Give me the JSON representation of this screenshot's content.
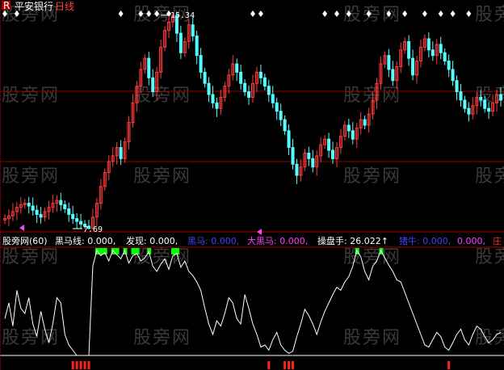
{
  "header": {
    "flag": "R",
    "stock_name": "平安银行",
    "period": "日线"
  },
  "watermark_text": "股旁网",
  "price_panel": {
    "high_label": "15.34",
    "low_label": "7.69",
    "colors": {
      "up": "#ff3a3a",
      "down": "#54ffff",
      "grid": "#8b0000",
      "signal": "#ffffff"
    }
  },
  "indicator_legend": {
    "prefix": "股旁网(60)",
    "items": [
      {
        "text": "黑马线: 0.000,",
        "color": "#ffffff"
      },
      {
        "text": "发现: 0.000,",
        "color": "#ffffff"
      },
      {
        "text": "黑马: 0.000,",
        "color": "#4040ff"
      },
      {
        "text": "大黑马: 0.000,",
        "color": "#ff40ff"
      },
      {
        "text": "操盘手: 26.022↑",
        "color": "#ffffff"
      },
      {
        "text": "猪牛: 0.000,",
        "color": "#4040ff"
      },
      {
        "text": "0.000,",
        "color": "#ff40ff"
      },
      {
        "text": "庄",
        "color": "#ff2020"
      }
    ]
  },
  "chart_data": {
    "type": "candlestick",
    "price_range": [
      7.69,
      15.34
    ],
    "marked_high": 15.34,
    "marked_low": 7.69,
    "close_series": [
      8.05,
      8.15,
      8.3,
      8.45,
      8.55,
      8.6,
      8.5,
      8.35,
      8.2,
      8.1,
      8.3,
      8.45,
      8.6,
      8.7,
      8.55,
      8.4,
      8.2,
      8.05,
      7.95,
      7.85,
      7.78,
      7.69,
      8.1,
      8.6,
      9.2,
      9.7,
      10.1,
      10.3,
      10.6,
      10.2,
      10.8,
      11.5,
      12.2,
      12.8,
      13.4,
      13.8,
      13.1,
      12.6,
      13.3,
      14.2,
      14.8,
      15.1,
      15.34,
      14.7,
      14.0,
      14.4,
      15.0,
      14.6,
      13.9,
      13.3,
      12.9,
      12.5,
      12.2,
      12.0,
      12.4,
      12.8,
      13.2,
      13.6,
      13.3,
      12.9,
      12.6,
      12.4,
      12.9,
      13.3,
      13.1,
      12.8,
      12.5,
      12.2,
      11.9,
      11.6,
      11.2,
      10.6,
      10.0,
      9.6,
      9.9,
      10.4,
      10.2,
      9.9,
      10.3,
      10.7,
      10.9,
      10.5,
      10.2,
      10.6,
      11.0,
      11.4,
      11.2,
      10.9,
      11.3,
      11.6,
      11.4,
      11.8,
      12.3,
      12.9,
      13.6,
      13.9,
      13.4,
      13.0,
      13.5,
      14.1,
      14.4,
      13.8,
      13.2,
      13.7,
      14.2,
      14.5,
      14.1,
      13.9,
      14.3,
      14.0,
      13.7,
      13.4,
      13.0,
      12.6,
      12.3,
      12.0,
      11.8,
      12.1,
      12.4,
      12.3,
      12.0,
      11.9,
      12.2,
      12.5,
      12.3
    ],
    "indicator_series": [
      0.35,
      0.5,
      0.28,
      0.62,
      0.45,
      0.4,
      0.55,
      0.3,
      0.18,
      0.42,
      0.25,
      0.12,
      0.3,
      0.55,
      0.5,
      0.2,
      0.1,
      0.05,
      0.0,
      0.0,
      0.0,
      0.0,
      0.85,
      1.0,
      0.95,
      0.98,
      0.9,
      1.0,
      0.96,
      0.92,
      1.0,
      0.88,
      0.95,
      0.97,
      0.9,
      0.93,
      0.99,
      0.85,
      0.8,
      0.87,
      0.92,
      0.82,
      0.95,
      0.97,
      0.84,
      0.9,
      0.8,
      0.76,
      0.7,
      0.62,
      0.45,
      0.3,
      0.2,
      0.33,
      0.28,
      0.4,
      0.55,
      0.5,
      0.35,
      0.3,
      0.58,
      0.45,
      0.3,
      0.2,
      0.08,
      0.1,
      0.05,
      0.15,
      0.22,
      0.1,
      0.05,
      0.02,
      0.04,
      0.18,
      0.3,
      0.44,
      0.38,
      0.3,
      0.2,
      0.32,
      0.42,
      0.5,
      0.58,
      0.65,
      0.62,
      0.7,
      0.75,
      0.85,
      1.0,
      0.94,
      0.8,
      0.72,
      0.85,
      0.9,
      1.0,
      0.93,
      0.86,
      0.8,
      0.72,
      0.7,
      0.6,
      0.5,
      0.4,
      0.3,
      0.2,
      0.1,
      0.08,
      0.15,
      0.22,
      0.18,
      0.08,
      0.05,
      0.12,
      0.2,
      0.25,
      0.15,
      0.1,
      0.2,
      0.28,
      0.25,
      0.18,
      0.12,
      0.15,
      0.2,
      0.22
    ],
    "top_signal_indices": [
      0,
      3,
      29,
      34,
      36,
      38,
      41,
      62,
      64,
      80,
      83,
      86,
      91,
      96,
      100,
      105,
      109,
      112,
      116
    ]
  }
}
